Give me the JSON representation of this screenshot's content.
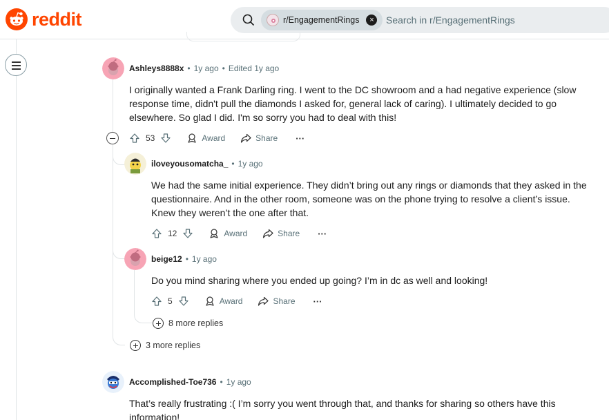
{
  "header": {
    "logo_text": "reddit",
    "subreddit_chip": "r/EngagementRings",
    "search_placeholder": "Search in r/EngagementRings"
  },
  "comments": [
    {
      "user": "Ashleys8888x",
      "time": "1y ago",
      "edited": "Edited 1y ago",
      "body": "I originally wanted a Frank Darling ring. I went to the DC showroom and a had negative experience (slow response time, didn't pull the diamonds I asked for, general lack of caring). I ultimately decided to go elsewhere. So glad I did. I'm so sorry you had to deal with this!",
      "votes": "53",
      "award": "Award",
      "share": "Share",
      "more": "···"
    },
    {
      "user": "iloveyousomatcha_",
      "time": "1y ago",
      "body": "We had the same initial experience. They didn’t bring out any rings or diamonds that they asked in the questionnaire. And in the other room, someone was on the phone trying to resolve a client’s issue. Knew they weren’t the one after that.",
      "votes": "12",
      "award": "Award",
      "share": "Share",
      "more": "···"
    },
    {
      "user": "beige12",
      "time": "1y ago",
      "body": "Do you mind sharing where you ended up going? I’m in dc as well and looking!",
      "votes": "5",
      "award": "Award",
      "share": "Share",
      "more": "···"
    },
    {
      "user": "Accomplished-Toe736",
      "time": "1y ago",
      "body": "That’s really frustrating :( I’m sorry you went through that, and thanks for sharing so others have this information!"
    }
  ],
  "more_replies": {
    "nested": "8 more replies",
    "top": "3 more replies"
  },
  "colors": {
    "brand": "#ff4500",
    "meta": "#576f76",
    "line": "#e0e4e6"
  }
}
